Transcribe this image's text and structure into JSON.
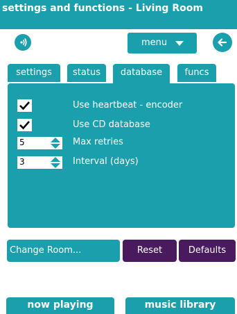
{
  "window": {
    "title": "settings and functions - Living Room"
  },
  "toolbar": {
    "menu_label": "menu",
    "speaker_icon": "speaker-icon",
    "back_icon": "back-arrow-icon"
  },
  "tabs": [
    {
      "label": "settings",
      "active": false
    },
    {
      "label": "status",
      "active": false
    },
    {
      "label": "database",
      "active": true
    },
    {
      "label": "funcs",
      "active": false
    }
  ],
  "options": {
    "heartbeat": {
      "label": "Use heartbeat - encoder",
      "checked": true
    },
    "cd_database": {
      "label": "Use CD database",
      "checked": true
    },
    "max_retries": {
      "label": "Max retries",
      "value": "5"
    },
    "interval": {
      "label": "Interval (days)",
      "value": "3"
    }
  },
  "actions": {
    "change_room": "Change Room...",
    "reset": "Reset",
    "defaults": "Defaults"
  },
  "bottom_tabs": {
    "now_playing": "now playing",
    "music_library": "music library"
  },
  "colors": {
    "teal": "#1aa0ad",
    "purple": "#4a1a5e",
    "white": "#ffffff"
  }
}
